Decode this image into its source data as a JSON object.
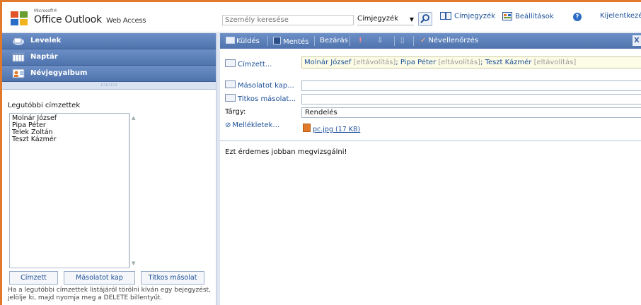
{
  "header": {
    "logo_microsoft": "Microsoft®",
    "logo_office": "Office Outlook",
    "logo_product": "Web Access",
    "search_placeholder": "Személy keresése",
    "search_scope": "Címjegyzék",
    "link_addressbook": "Címjegyzék",
    "link_settings": "Beállítások",
    "link_logout": "Kijelentkezés"
  },
  "nav": {
    "items": [
      {
        "label": "Levelek",
        "icon": "mail-icon"
      },
      {
        "label": "Naptár",
        "icon": "calendar-icon"
      },
      {
        "label": "Névjegyalbum",
        "icon": "contacts-icon"
      }
    ]
  },
  "recent": {
    "title": "Legutóbbi címzettek",
    "names": [
      "Molnár József",
      "Pipa Péter",
      "Telek Zoltán",
      "Teszt Kázmér"
    ],
    "btn_to": "Címzett",
    "btn_cc": "Másolatot kap",
    "btn_bcc": "Titkos másolat",
    "note": "Ha a legutóbbi címzettek listájáról törölni kíván egy bejegyzést, jelölje ki, majd nyomja meg a DELETE billentyűt."
  },
  "toolbar": {
    "send": "Küldés",
    "save": "Mentés",
    "close": "Bezárás",
    "spellcheck": "Névellenőrzés",
    "close_x": "X"
  },
  "compose": {
    "to_label": "Címzett...",
    "cc_label": "Másolatot kap...",
    "bcc_label": "Titkos másolat...",
    "subject_label": "Tárgy:",
    "attachments_label": "Mellékletek...",
    "recipients": [
      {
        "name": "Molnár József",
        "remove": "[eltávolítás]",
        "sep": ";"
      },
      {
        "name": "Pipa Péter",
        "remove": "[eltávolítás]",
        "sep": ";"
      },
      {
        "name": "Teszt Kázmér",
        "remove": "[eltávolítás]",
        "sep": ""
      }
    ],
    "subject": "Rendelés",
    "attachment": "pc.jpg (17 KB)",
    "body": "Ezt érdemes jobban megvizsgálni!"
  },
  "colors": {
    "accent_orange": "#e07a2a",
    "nav_blue": "#4f73ad",
    "link_blue": "#1b4f97"
  }
}
